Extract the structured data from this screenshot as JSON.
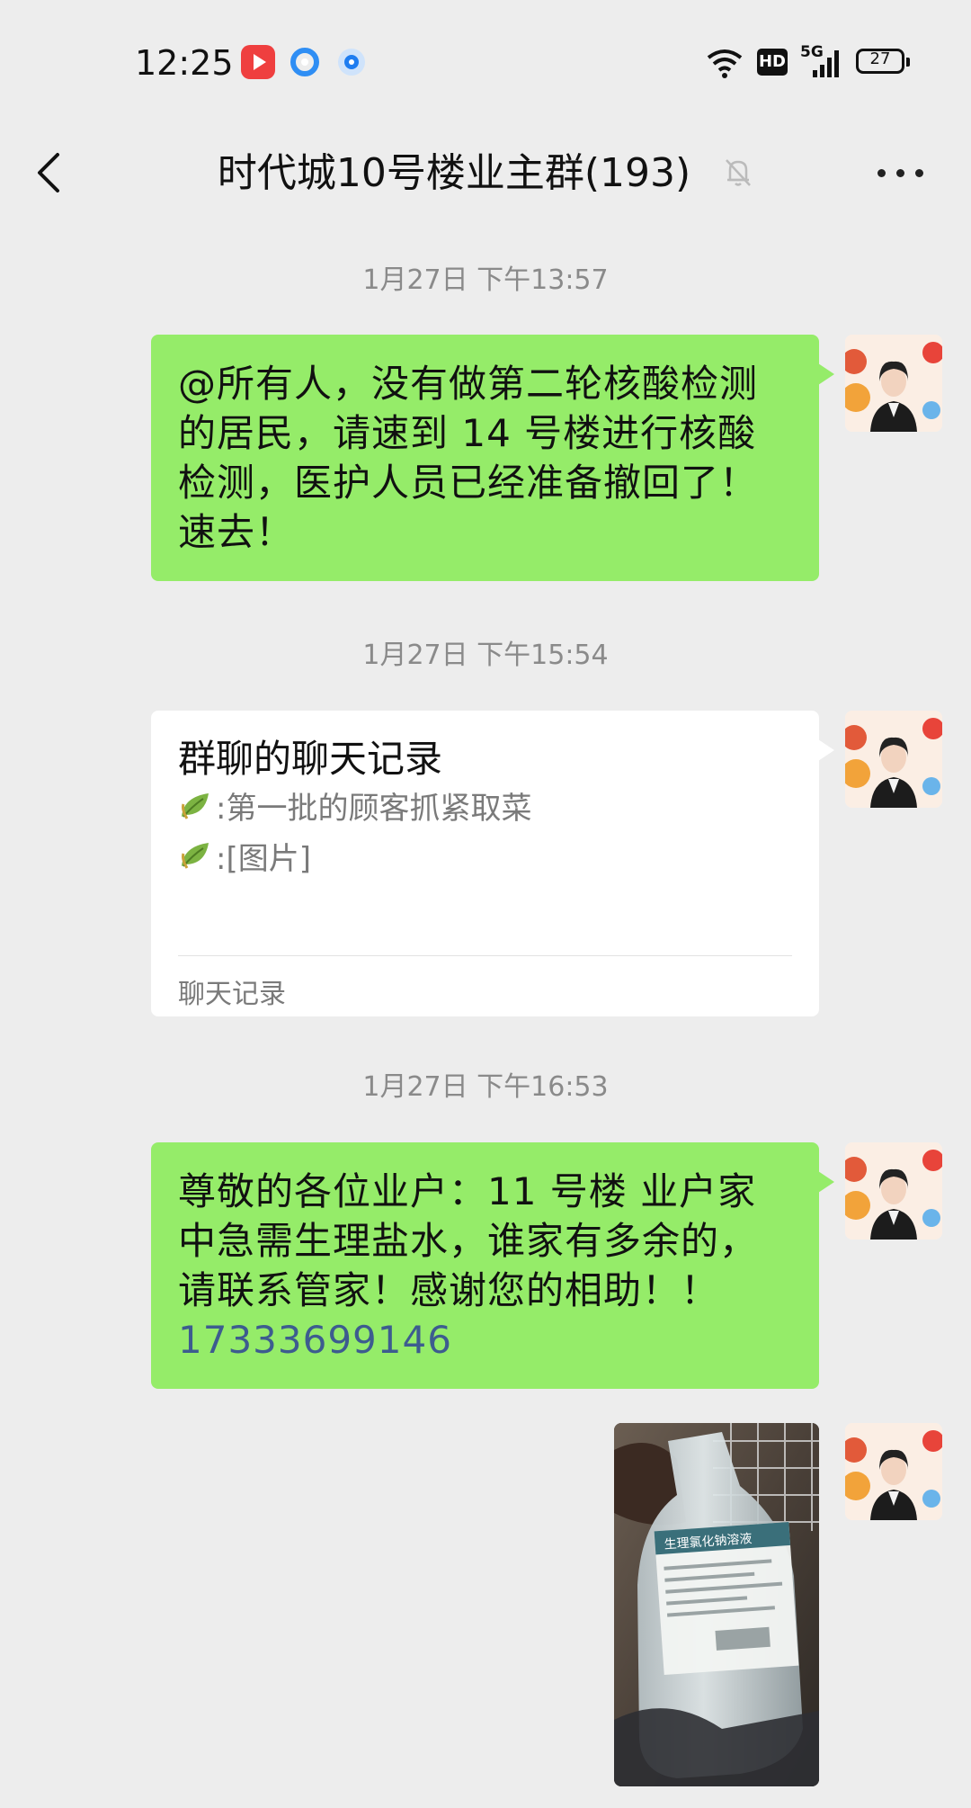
{
  "status_bar": {
    "time": "12:25",
    "network": "5G",
    "hd": "HD",
    "battery": "27",
    "app_icons": [
      "video-app-icon",
      "browser-app-icon",
      "assistant-app-icon"
    ],
    "icons": [
      "wifi-icon",
      "hd-icon",
      "signal-icon",
      "battery-icon"
    ]
  },
  "header": {
    "title": "时代城10号楼业主群(193)",
    "icons": [
      "back-arrow-icon",
      "mute-bell-icon",
      "more-icon"
    ]
  },
  "messages": [
    {
      "type": "timestamp",
      "text": "1月27日 下午13:57"
    },
    {
      "type": "text",
      "sender": "self",
      "lines": [
        "@所有人，没有做第二轮核酸检测",
        "的居民，请速到 14 号楼进行核酸",
        "检测，医护人员已经准备撤回了！",
        "速去！"
      ]
    },
    {
      "type": "timestamp",
      "text": "1月27日 下午15:54"
    },
    {
      "type": "chat_record",
      "sender": "self",
      "title": "群聊的聊天记录",
      "items": [
        ":第一批的顾客抓紧取菜",
        ":[图片]"
      ],
      "footer": "聊天记录"
    },
    {
      "type": "timestamp",
      "text": "1月27日 下午16:53"
    },
    {
      "type": "text",
      "sender": "self",
      "lines": [
        "尊敬的各位业户：11 号楼 业户家",
        "中急需生理盐水，谁家有多余的，",
        "请联系管家！感谢您的相助！！"
      ],
      "phone": "17333699146"
    },
    {
      "type": "image",
      "sender": "self",
      "label_text": "生理氯化钠溶液"
    }
  ],
  "colors": {
    "background": "#ededed",
    "bubble_green": "#95ec69",
    "card_white": "#ffffff",
    "timestamp_gray": "#8a8a8a",
    "link_blue": "#3d5c8f"
  }
}
